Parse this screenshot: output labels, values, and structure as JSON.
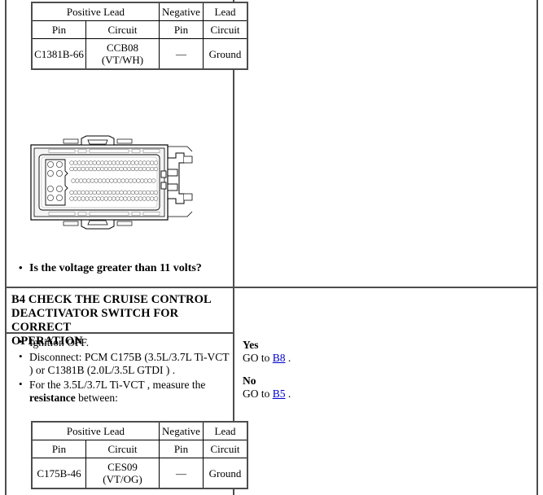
{
  "document": {
    "type": "pinpoint-test-procedure",
    "link_color": "#0000cc"
  },
  "step_b3_continued": {
    "table": {
      "group_headers": [
        "Positive Lead",
        "Negative Lead"
      ],
      "group_header_left": "Positive Lead",
      "group_header_mid": "Negative",
      "group_header_right": "Lead",
      "sub_headers": [
        "Pin",
        "Circuit",
        "Pin",
        "Circuit"
      ],
      "rows": [
        {
          "pin_positive": "C1381B-66",
          "circuit_positive": "CCB08 (VT/WH)",
          "pin_negative": "—",
          "circuit_negative": "Ground"
        }
      ]
    },
    "figure": {
      "name": "pcm-connector-face-view",
      "caption": ""
    },
    "question": "Is the voltage greater than 11 volts?"
  },
  "step_b4": {
    "heading": "B4 CHECK THE CRUISE CONTROL DEACTIVATOR SWITCH FOR CORRECT OPERATION",
    "heading_lines": [
      "B4 CHECK THE CRUISE CONTROL",
      "DEACTIVATOR SWITCH FOR CORRECT",
      "OPERATION"
    ],
    "instructions": [
      "Ignition OFF.",
      "Disconnect: PCM C175B (3.5L/3.7L Ti-VCT ) or C1381B (2.0L/3.5L GTDI ) .",
      "For the 3.5L/3.7L Ti-VCT , measure the resistance between:"
    ],
    "instruction_3_prefix": "For the 3.5L/3.7L Ti-VCT , measure the ",
    "instruction_3_bold": "resistance",
    "instruction_3_suffix": " between:",
    "table": {
      "group_header_left": "Positive Lead",
      "group_header_mid": "Negative",
      "group_header_right": "Lead",
      "sub_headers": [
        "Pin",
        "Circuit",
        "Pin",
        "Circuit"
      ],
      "rows": [
        {
          "pin_positive": "C175B-46",
          "circuit_positive": "CES09 (VT/OG)",
          "pin_negative": "—",
          "circuit_negative": "Ground"
        }
      ]
    },
    "actions": {
      "yes_label": "Yes",
      "yes_text_prefix": "GO to ",
      "yes_link": "B8",
      "yes_text_suffix": " .",
      "no_label": "No",
      "no_text_prefix": "GO to ",
      "no_link": "B5",
      "no_text_suffix": " ."
    }
  }
}
